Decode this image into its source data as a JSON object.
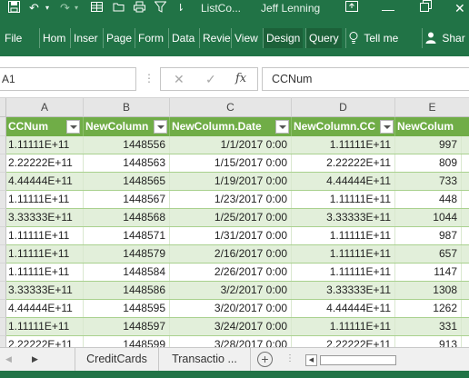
{
  "titlebar": {
    "title": "ListCo...",
    "user": "Jeff Lenning",
    "save_icon": "save-icon",
    "undo_icon": "undo-icon",
    "redo_icon": "redo-icon",
    "customize_icon": "customize-qat-icon"
  },
  "ribbon": {
    "tabs": [
      "File",
      "Hom",
      "Inser",
      "Page",
      "Form",
      "Data",
      "Revie",
      "View",
      "Design",
      "Query"
    ],
    "tell_me": "Tell me",
    "share": "Shar"
  },
  "formula_bar": {
    "name_box": "A1",
    "cancel_icon": "✕",
    "enter_icon": "✓",
    "fx": "fx",
    "content": "CCNum"
  },
  "grid": {
    "columns": [
      "A",
      "B",
      "C",
      "D",
      "E"
    ],
    "headers": [
      "CCNum",
      "NewColumn",
      "NewColumn.Date",
      "NewColumn.CC",
      "NewColum"
    ],
    "rows": [
      [
        "1.11111E+11",
        "1448556",
        "1/1/2017 0:00",
        "1.11111E+11",
        "997"
      ],
      [
        "2.22222E+11",
        "1448563",
        "1/15/2017 0:00",
        "2.22222E+11",
        "809"
      ],
      [
        "4.44444E+11",
        "1448565",
        "1/19/2017 0:00",
        "4.44444E+11",
        "733"
      ],
      [
        "1.11111E+11",
        "1448567",
        "1/23/2017 0:00",
        "1.11111E+11",
        "448"
      ],
      [
        "3.33333E+11",
        "1448568",
        "1/25/2017 0:00",
        "3.33333E+11",
        "1044"
      ],
      [
        "1.11111E+11",
        "1448571",
        "1/31/2017 0:00",
        "1.11111E+11",
        "987"
      ],
      [
        "1.11111E+11",
        "1448579",
        "2/16/2017 0:00",
        "1.11111E+11",
        "657"
      ],
      [
        "1.11111E+11",
        "1448584",
        "2/26/2017 0:00",
        "1.11111E+11",
        "1147"
      ],
      [
        "3.33333E+11",
        "1448586",
        "3/2/2017 0:00",
        "3.33333E+11",
        "1308"
      ],
      [
        "4.44444E+11",
        "1448595",
        "3/20/2017 0:00",
        "4.44444E+11",
        "1262"
      ],
      [
        "1.11111E+11",
        "1448597",
        "3/24/2017 0:00",
        "1.11111E+11",
        "331"
      ],
      [
        "2.22222E+11",
        "1448599",
        "3/28/2017 0:00",
        "2.22222E+11",
        "913"
      ]
    ]
  },
  "sheets": {
    "tabs": [
      "CreditCards",
      "Transactio ..."
    ],
    "add_label": "+",
    "menu_dots": "⋮"
  }
}
